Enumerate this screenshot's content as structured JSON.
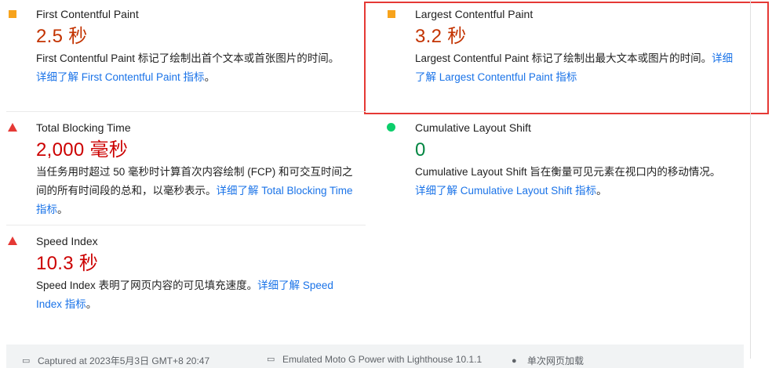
{
  "metrics": {
    "fcp": {
      "title": "First Contentful Paint",
      "value": "2.5 秒",
      "desc": "First Contentful Paint 标记了绘制出首个文本或首张图片的时间。",
      "link": "详细了解 First Contentful Paint 指标",
      "link_suffix": "。",
      "status_icon": "average-square-icon",
      "color": "#c33300"
    },
    "lcp": {
      "title": "Largest Contentful Paint",
      "value": "3.2 秒",
      "desc": "Largest Contentful Paint 标记了绘制出最大文本或图片的时间。",
      "link": "详细了解 Largest Contentful Paint 指标",
      "link_suffix": "",
      "status_icon": "average-square-icon",
      "color": "#c33300"
    },
    "tbt": {
      "title": "Total Blocking Time",
      "value": "2,000 毫秒",
      "desc": "当任务用时超过 50 毫秒时计算首次内容绘制 (FCP) 和可交互时间之间的所有时间段的总和，以毫秒表示。",
      "link": "详细了解 Total Blocking Time 指标",
      "link_suffix": "。",
      "status_icon": "fail-triangle-icon",
      "color": "#cc0000"
    },
    "cls": {
      "title": "Cumulative Layout Shift",
      "value": "0",
      "desc": "Cumulative Layout Shift 旨在衡量可见元素在视口内的移动情况。",
      "link": "详细了解 Cumulative Layout Shift 指标",
      "link_suffix": "。",
      "status_icon": "pass-circle-icon",
      "color": "#018642"
    },
    "si": {
      "title": "Speed Index",
      "value": "10.3 秒",
      "desc": "Speed Index 表明了网页内容的可见填充速度。",
      "link": "详细了解 Speed Index 指标",
      "link_suffix": "。",
      "status_icon": "fail-triangle-icon",
      "color": "#cc0000"
    }
  },
  "footer": {
    "captured": "Captured at 2023年5月3日 GMT+8 20:47",
    "device": "Emulated Moto G Power with Lighthouse 10.1.1",
    "load": "单次网页加载"
  }
}
